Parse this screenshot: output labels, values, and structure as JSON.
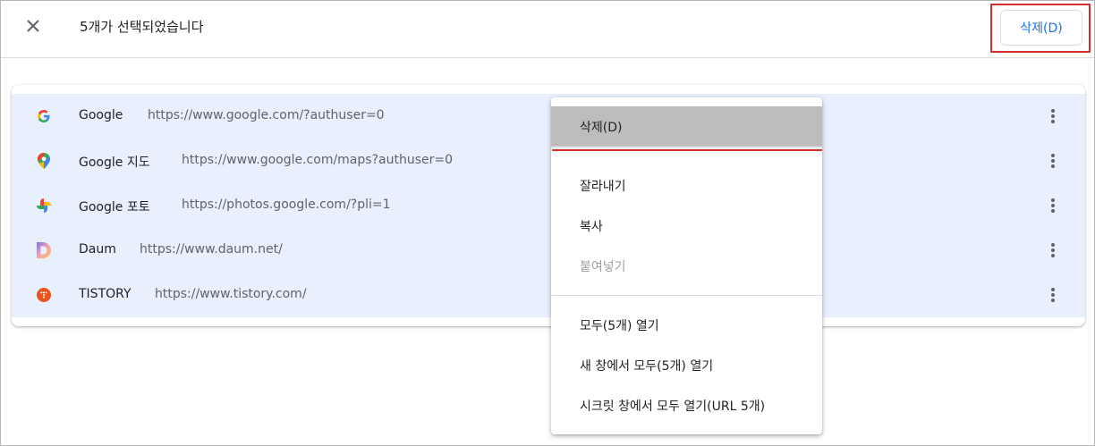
{
  "selection_bar": {
    "count_text": "5개가 선택되었습니다",
    "delete_label": "삭제(D)"
  },
  "bookmarks": [
    {
      "title": "Google",
      "url": "https://www.google.com/?authuser=0",
      "icon": "google-icon"
    },
    {
      "title": "Google 지도",
      "url": "https://www.google.com/maps?authuser=0",
      "icon": "google-maps-icon"
    },
    {
      "title": "Google 포토",
      "url": "https://photos.google.com/?pli=1",
      "icon": "google-photos-icon"
    },
    {
      "title": "Daum",
      "url": "https://www.daum.net/",
      "icon": "daum-icon"
    },
    {
      "title": "TISTORY",
      "url": "https://www.tistory.com/",
      "icon": "tistory-icon"
    }
  ],
  "context_menu": {
    "items": [
      {
        "label": "삭제(D)",
        "state": "highlighted"
      },
      {
        "label": "잘라내기",
        "state": "normal"
      },
      {
        "label": "복사",
        "state": "normal"
      },
      {
        "label": "붙여넣기",
        "state": "disabled"
      },
      {
        "label": "모두(5개) 열기",
        "state": "normal"
      },
      {
        "label": "새 창에서 모두(5개) 열기",
        "state": "normal"
      },
      {
        "label": "시크릿 창에서 모두 열기(URL 5개)",
        "state": "normal"
      }
    ]
  },
  "colors": {
    "accent": "#1a73e8",
    "selected_row": "#e8f0fe",
    "annotation_red": "#d32f2f"
  }
}
